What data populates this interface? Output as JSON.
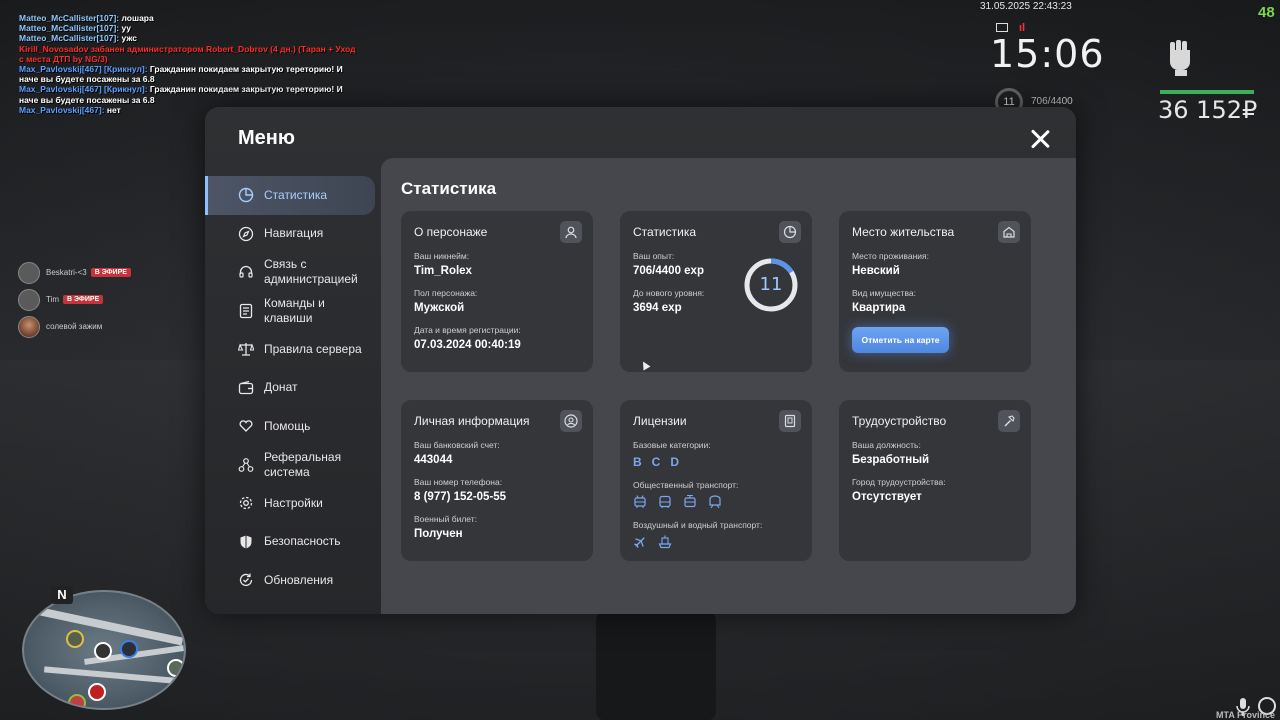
{
  "chat": [
    {
      "nick": "Matteo_McCallister[107]:",
      "text": " лошара",
      "nick_color": "nick"
    },
    {
      "nick": "Matteo_McCallister[107]:",
      "text": " уу",
      "nick_color": "nick"
    },
    {
      "nick": "Matteo_McCallister[107]:",
      "text": " ужс",
      "nick_color": "nick"
    },
    {
      "nick": "Kirill_Novosadov забанен администратором Robert_Dobrov (4 дн.) (Таран + Уход",
      "text": "",
      "nick_color": "red"
    },
    {
      "nick": " с места ДТП by NG/3)",
      "text": "",
      "nick_color": "red"
    },
    {
      "nick": "Max_Pavlovskij[467] [Крикнул]:",
      "text": " Гражданин покидаем закрытую тереторию! И",
      "nick_color": "blue"
    },
    {
      "nick": "",
      "text": "наче вы будете посажены за 6.8",
      "nick_color": "nick"
    },
    {
      "nick": "Max_Pavlovskij[467] [Крикнул]:",
      "text": " Гражданин покидаем закрытую тереторию! И",
      "nick_color": "blue"
    },
    {
      "nick": "",
      "text": "наче вы будете посажены за 6.8",
      "nick_color": "nick"
    },
    {
      "nick": "Max_Pavlovskij[467]:",
      "text": " нет",
      "nick_color": "blue"
    }
  ],
  "hud": {
    "date": "31.05.2025 22:43:23",
    "fps": "48",
    "signal": "ıl",
    "time": "15:06",
    "level": "11",
    "exp": "706/4400",
    "money": "36 152₽",
    "watermark": "MTA Province"
  },
  "voice": [
    {
      "name": "Beskatri-<3",
      "badge": "В ЭФИРЕ"
    },
    {
      "name": "Tim",
      "badge": "В ЭФИРЕ"
    },
    {
      "name": "солевой зажим",
      "badge": ""
    }
  ],
  "minimap": {
    "north": "N"
  },
  "menu": {
    "title": "Меню",
    "nav": [
      {
        "label": "Статистика",
        "icon": "pie-chart-icon"
      },
      {
        "label": "Навигация",
        "icon": "compass-icon"
      },
      {
        "label": "Связь с\nадминистрацией",
        "icon": "headset-icon"
      },
      {
        "label": "Команды и\nклавиши",
        "icon": "document-icon"
      },
      {
        "label": "Правила сервера",
        "icon": "scales-icon"
      },
      {
        "label": "Донат",
        "icon": "wallet-icon"
      },
      {
        "label": "Помощь",
        "icon": "heart-hand-icon"
      },
      {
        "label": "Реферальная\nсистема",
        "icon": "network-icon"
      },
      {
        "label": "Настройки",
        "icon": "gear-icon"
      },
      {
        "label": "Безопасность",
        "icon": "shield-icon"
      },
      {
        "label": "Обновления",
        "icon": "refresh-check-icon"
      }
    ]
  },
  "stats": {
    "title": "Статистика",
    "character": {
      "title": "О персонаже",
      "nickname_label": "Ваш никнейм:",
      "nickname": "Tim_Rolex",
      "gender_label": "Пол персонажа:",
      "gender": "Мужской",
      "reg_label": "Дата и время регистрации:",
      "reg": "07.03.2024 00:40:19"
    },
    "statistics": {
      "title": "Статистика",
      "exp_label": "Ваш опыт:",
      "exp": "706/4400 exp",
      "next_label": "До нового уровня:",
      "next": "3694 exp",
      "level": "11",
      "progress": 0.16
    },
    "residence": {
      "title": "Место жительства",
      "place_label": "Место проживания:",
      "place": "Невский",
      "type_label": "Вид имущества:",
      "type": "Квартира",
      "button": "Отметить на карте"
    },
    "personal": {
      "title": "Личная информация",
      "bank_label": "Ваш банковский счет:",
      "bank": "443044",
      "phone_label": "Ваш номер телефона:",
      "phone": "8 (977) 152-05-55",
      "military_label": "Военный билет:",
      "military": "Получен"
    },
    "licenses": {
      "title": "Лицензии",
      "basic_label": "Базовые категории:",
      "basic": [
        "B",
        "C",
        "D"
      ],
      "public_label": "Общественный транспорт:",
      "air_label": "Воздушный и водный транспорт:"
    },
    "employment": {
      "title": "Трудоустройство",
      "position_label": "Ваша должность:",
      "position": "Безработный",
      "city_label": "Город трудоустройства:",
      "city": "Отсутствует"
    }
  },
  "colors": {
    "accent": "#7aa8f0",
    "button": "#5b93ea",
    "active_nav": "#a9cdfa",
    "badge": "#c8323a",
    "fps": "#7bd64a",
    "money_bar": "#3fae5b"
  }
}
